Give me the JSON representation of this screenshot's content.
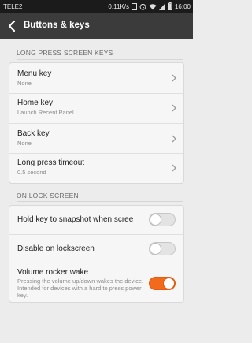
{
  "status_bar": {
    "carrier": "TELE2",
    "speed": "0.11K/s",
    "time": "16:00",
    "icons": [
      "sim-icon",
      "alarm-icon",
      "wifi-icon",
      "signal-icon",
      "battery-icon"
    ]
  },
  "header": {
    "title": "Buttons & keys",
    "back_icon": "back-arrow-icon"
  },
  "sections": {
    "long_press": {
      "title": "LONG PRESS SCREEN KEYS",
      "items": [
        {
          "label": "Menu key",
          "value": "None"
        },
        {
          "label": "Home key",
          "value": "Launch Recent Panel"
        },
        {
          "label": "Back key",
          "value": "None"
        },
        {
          "label": "Long press timeout",
          "value": "0.5 second"
        }
      ]
    },
    "lock_screen": {
      "title": "ON LOCK SCREEN",
      "items": [
        {
          "label": "Hold key to snapshot when scree",
          "enabled": false
        },
        {
          "label": "Disable on lockscreen",
          "enabled": false
        },
        {
          "label": "Volume rocker wake",
          "description": "Pressing the volume up/down wakes the device. Intended for devices with a hard to press power key.",
          "enabled": true
        }
      ]
    }
  },
  "colors": {
    "accent": "#f26a1b",
    "titlebar": "#3b3b3b",
    "background": "#ececec"
  }
}
